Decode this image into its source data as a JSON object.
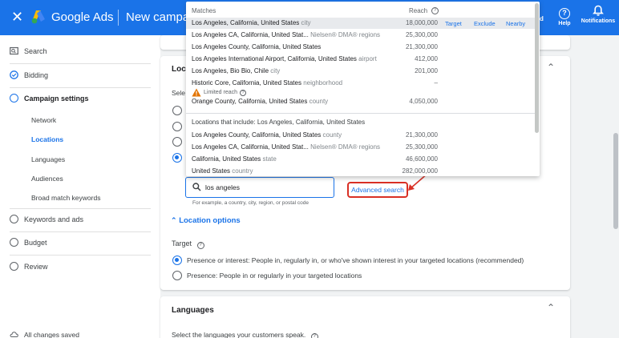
{
  "topbar": {
    "close_icon": "close-icon",
    "app_title": "Google Ads",
    "campaign_title": "New campaign",
    "cut_label": "d",
    "help_label": "Help",
    "help_icon": "?",
    "notifications_label": "Notifications",
    "notifications_icon": "bell-icon"
  },
  "sidebar": {
    "search": "Search",
    "bidding": "Bidding",
    "campaign_settings": "Campaign settings",
    "network": "Network",
    "locations": "Locations",
    "languages": "Languages",
    "audiences": "Audiences",
    "broad_match": "Broad match keywords",
    "keywords_ads": "Keywords and ads",
    "budget": "Budget",
    "review": "Review",
    "saved": "All changes saved"
  },
  "locations_card": {
    "header": "Loc",
    "select_text": "Sele",
    "search_value": "los angeles",
    "hint": "For example, a country, city, region, or postal code",
    "advanced_search": "Advanced search",
    "location_options": "Location options",
    "target_label": "Target",
    "option_presence_interest": "Presence or interest: People in, regularly in, or who've shown interest in your targeted locations (recommended)",
    "option_presence": "Presence: People in or regularly in your targeted locations"
  },
  "languages_card": {
    "header": "Languages",
    "subtitle": "Select the languages your customers speak."
  },
  "dropdown": {
    "matches_label": "Matches",
    "reach_label": "Reach",
    "actions": {
      "target": "Target",
      "exclude": "Exclude",
      "nearby": "Nearby"
    },
    "matches": [
      {
        "name": "Los Angeles, California, United States",
        "type": "city",
        "reach": "18,000,000"
      },
      {
        "name": "Los Angeles CA, California, United Stat...",
        "type": "Nielsen® DMA® regions",
        "reach": "25,300,000"
      },
      {
        "name": "Los Angeles County, California, United States",
        "type": "",
        "reach": "21,300,000"
      },
      {
        "name": "Los Angeles International Airport, California, United States",
        "type": "airport",
        "reach": "412,000"
      },
      {
        "name": "Los Angeles, Bio Bio, Chile",
        "type": "city",
        "reach": "201,000"
      },
      {
        "name": "Historic Core, California, United States",
        "type": "neighborhood",
        "reach": "–"
      },
      {
        "name": "Orange County, California, United States",
        "type": "county",
        "reach": "4,050,000"
      }
    ],
    "limited_reach": "Limited reach",
    "includes_header": "Locations that include: Los Angeles, California, United States",
    "includes": [
      {
        "name": "Los Angeles County, California, United States",
        "type": "county",
        "reach": "21,300,000"
      },
      {
        "name": "Los Angeles CA, California, United Stat...",
        "type": "Nielsen® DMA® regions",
        "reach": "25,300,000"
      },
      {
        "name": "California, United States",
        "type": "state",
        "reach": "46,600,000"
      },
      {
        "name": "United States",
        "type": "country",
        "reach": "282,000,000"
      }
    ]
  },
  "colors": {
    "brand_blue": "#1a73e8",
    "highlight_red": "#d93025"
  }
}
